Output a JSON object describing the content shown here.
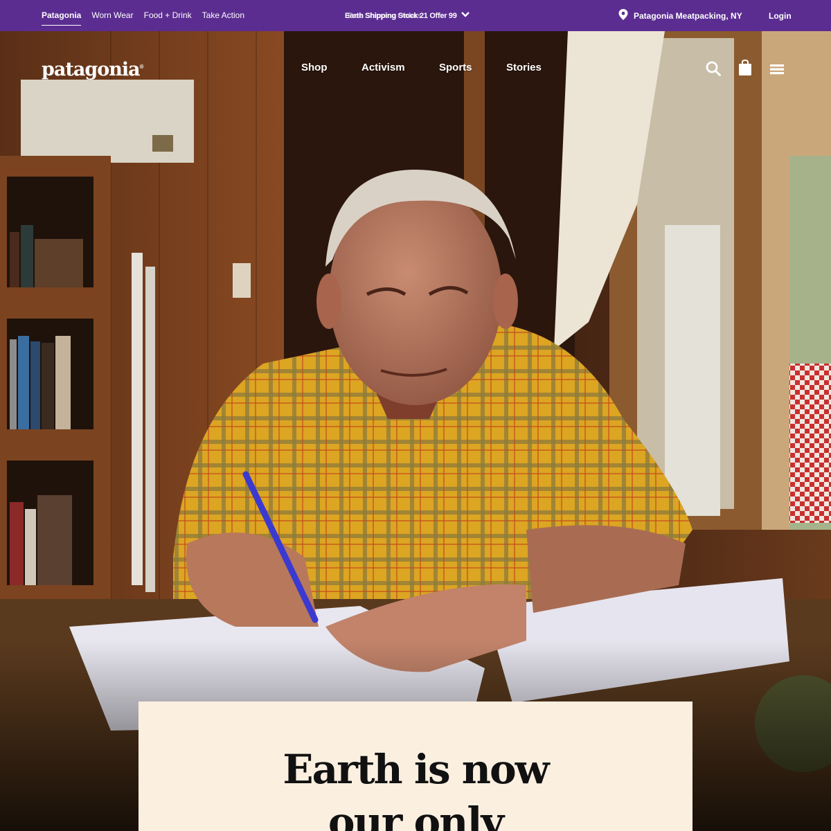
{
  "topbar": {
    "brands": [
      "Patagonia",
      "Worn Wear",
      "Food + Drink",
      "Take Action"
    ],
    "promo_text": "Earth Shipping Stock 21 Offer 99",
    "promo_ghost": "Free Shipping Orders",
    "store": "Patagonia Meatpacking, NY",
    "login": "Login"
  },
  "nav": {
    "logo": "patagonia",
    "logo_mark": "®",
    "links": [
      "Shop",
      "Activism",
      "Sports",
      "Stories"
    ]
  },
  "hero": {
    "headline_lines": [
      "Earth is now",
      "our only"
    ]
  },
  "colors": {
    "topbar": "#5b2d91",
    "card": "#fbefe0",
    "shirt": "#d9a21e"
  },
  "icons": [
    "location-pin-icon",
    "chevron-down-icon",
    "search-icon",
    "bag-icon",
    "menu-icon"
  ]
}
